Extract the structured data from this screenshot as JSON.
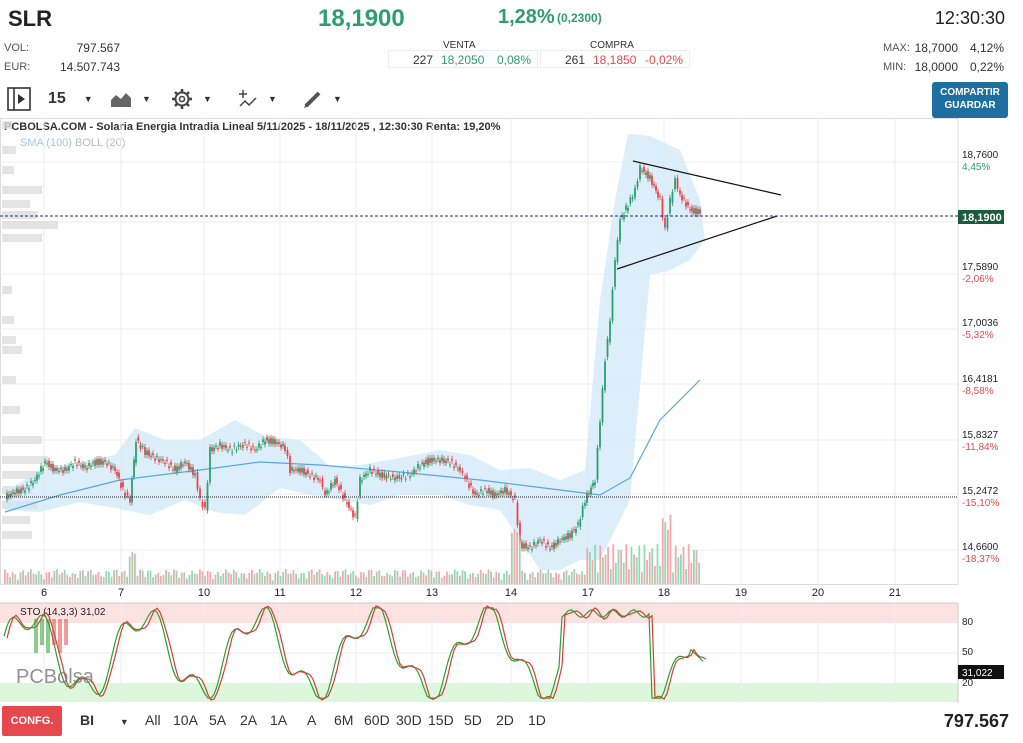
{
  "header": {
    "ticker": "SLR",
    "price": "18,1900",
    "change_pct": "1,28%",
    "change_abs": "(0,2300)",
    "time": "12:30:30",
    "vol_label": "VOL:",
    "vol_value": "797.567",
    "eur_label": "EUR:",
    "eur_value": "14.507.743",
    "max_label": "MAX:",
    "max_value": "18,7000",
    "max_pct": "4,12%",
    "min_label": "MIN:",
    "min_value": "18,0000",
    "min_pct": "0,22%"
  },
  "book": {
    "venta_label": "VENTA",
    "venta_qty": "227",
    "venta_price": "18,2050",
    "venta_pct": "0,08%",
    "compra_label": "COMPRA",
    "compra_qty": "261",
    "compra_price": "18,1850",
    "compra_pct": "-0,02%"
  },
  "toolbar": {
    "interval": "15",
    "share_line1": "COMPARTIR",
    "share_line2": "GUARDAR"
  },
  "chart": {
    "title": "PCBOLSA.COM - Solaria Energia Intradia Lineal 5/11/2025 - 18/11/2025 , 12:30:30 Renta: 19,20%",
    "sma_label": "SMA (100)",
    "boll_label": "BOLL (20)",
    "current_price_tag": "18,1900",
    "price_levels": [
      {
        "price": "18,7600",
        "pct": "4,45%",
        "dir": "up"
      },
      {
        "price": "17,5890",
        "pct": "-2,06%",
        "dir": "down"
      },
      {
        "price": "17,0036",
        "pct": "-5,32%",
        "dir": "down"
      },
      {
        "price": "16,4181",
        "pct": "-8,58%",
        "dir": "down"
      },
      {
        "price": "15,8327",
        "pct": "-11,84%",
        "dir": "down"
      },
      {
        "price": "15,2472",
        "pct": "-15,10%",
        "dir": "down"
      },
      {
        "price": "14,6600",
        "pct": "-18,37%",
        "dir": "down"
      }
    ],
    "x_labels": [
      "6",
      "7",
      "10",
      "11",
      "12",
      "13",
      "14",
      "17",
      "18",
      "19",
      "20",
      "21"
    ],
    "stochastic_label": "STO (14,3,3)",
    "stochastic_value": "31,02",
    "stochastic_levels": [
      "80",
      "50",
      "20"
    ],
    "stochastic_tag": "31,022",
    "watermark": "PCBolsa"
  },
  "bottom": {
    "config_label": "CONFG.",
    "bi_label": "BI",
    "ranges": [
      "All",
      "10A",
      "5A",
      "2A",
      "1A",
      "A",
      "6M",
      "60D",
      "30D",
      "15D",
      "5D",
      "2D",
      "1D"
    ],
    "volume_total": "797.567"
  },
  "colors": {
    "up": "#2e9e6e",
    "down": "#e5484d",
    "band": "#cfe7fa",
    "accent": "#1e6fa0"
  }
}
